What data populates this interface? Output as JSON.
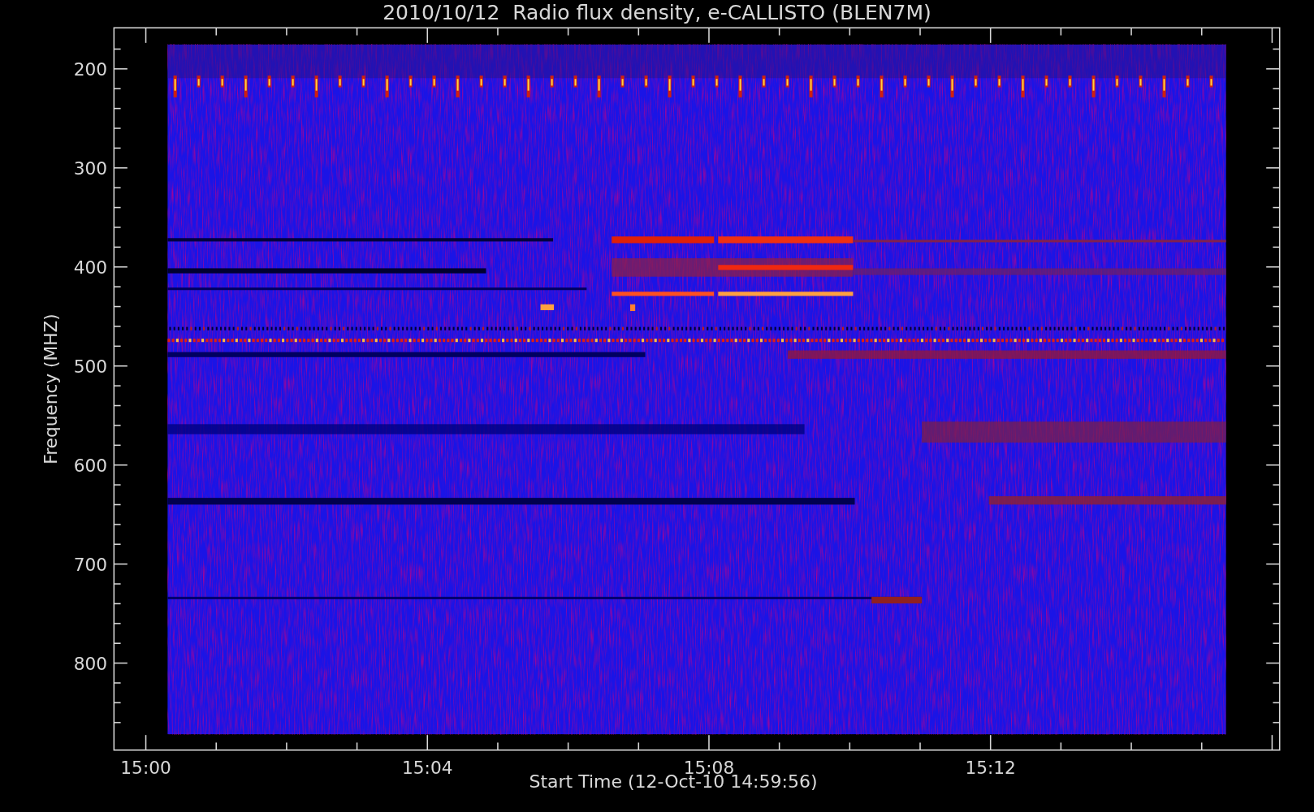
{
  "title": "2010/10/12  Radio flux density, e-CALLISTO (BLEN7M)",
  "chart": {
    "ylabel": "Frequency (MHZ)",
    "xlabel": "Start Time (12-Oct-10 14:59:56)",
    "yticks": [
      "200",
      "300",
      "400",
      "500",
      "600",
      "700",
      "800"
    ],
    "xticks": [
      "15:00",
      "15:04",
      "15:08",
      "15:12"
    ]
  }
}
